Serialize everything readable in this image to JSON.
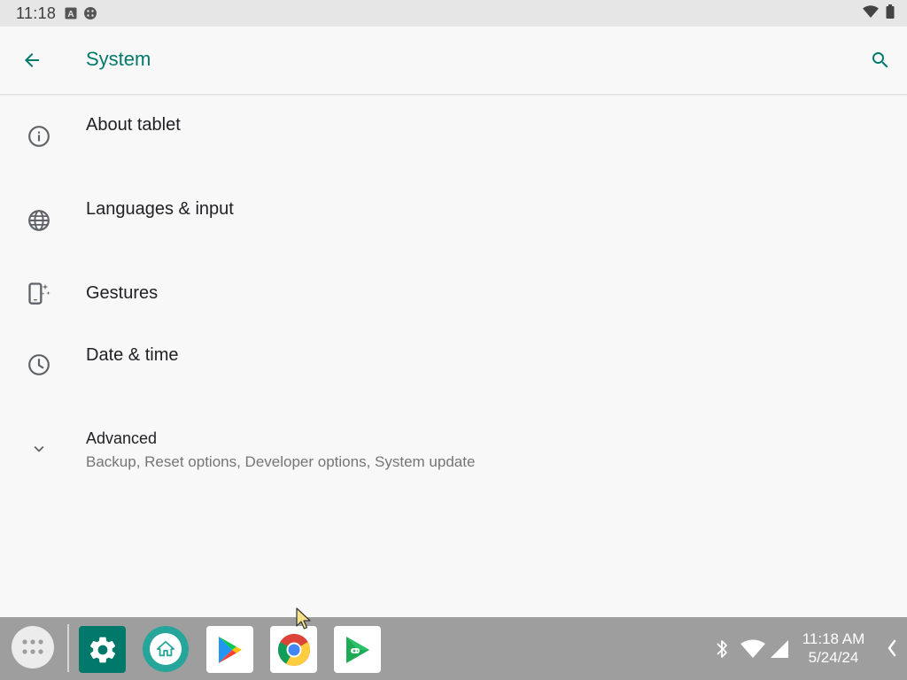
{
  "status_bar": {
    "time": "11:18",
    "left_icons": [
      "a-box-icon",
      "dot-grid-icon"
    ],
    "right_icons": [
      "wifi-icon",
      "battery-icon"
    ]
  },
  "app_bar": {
    "title": "System",
    "back_icon": "arrow-back-icon",
    "search_icon": "search-icon",
    "accent_color": "#00796b"
  },
  "items": [
    {
      "id": "about",
      "title": "About tablet",
      "icon": "info-icon"
    },
    {
      "id": "languages",
      "title": "Languages & input",
      "icon": "globe-icon"
    },
    {
      "id": "gestures",
      "title": "Gestures",
      "icon": "gesture-phone-icon"
    },
    {
      "id": "datetime",
      "title": "Date & time",
      "icon": "clock-icon"
    },
    {
      "id": "advanced",
      "title": "Advanced",
      "subtitle": "Backup, Reset options, Developer options, System update",
      "icon": "chevron-down-icon"
    }
  ],
  "taskbar": {
    "apps": [
      "Settings",
      "Home",
      "Play Store",
      "Chrome",
      "Play Games"
    ],
    "clock_time": "11:18 AM",
    "clock_date": "5/24/24"
  }
}
